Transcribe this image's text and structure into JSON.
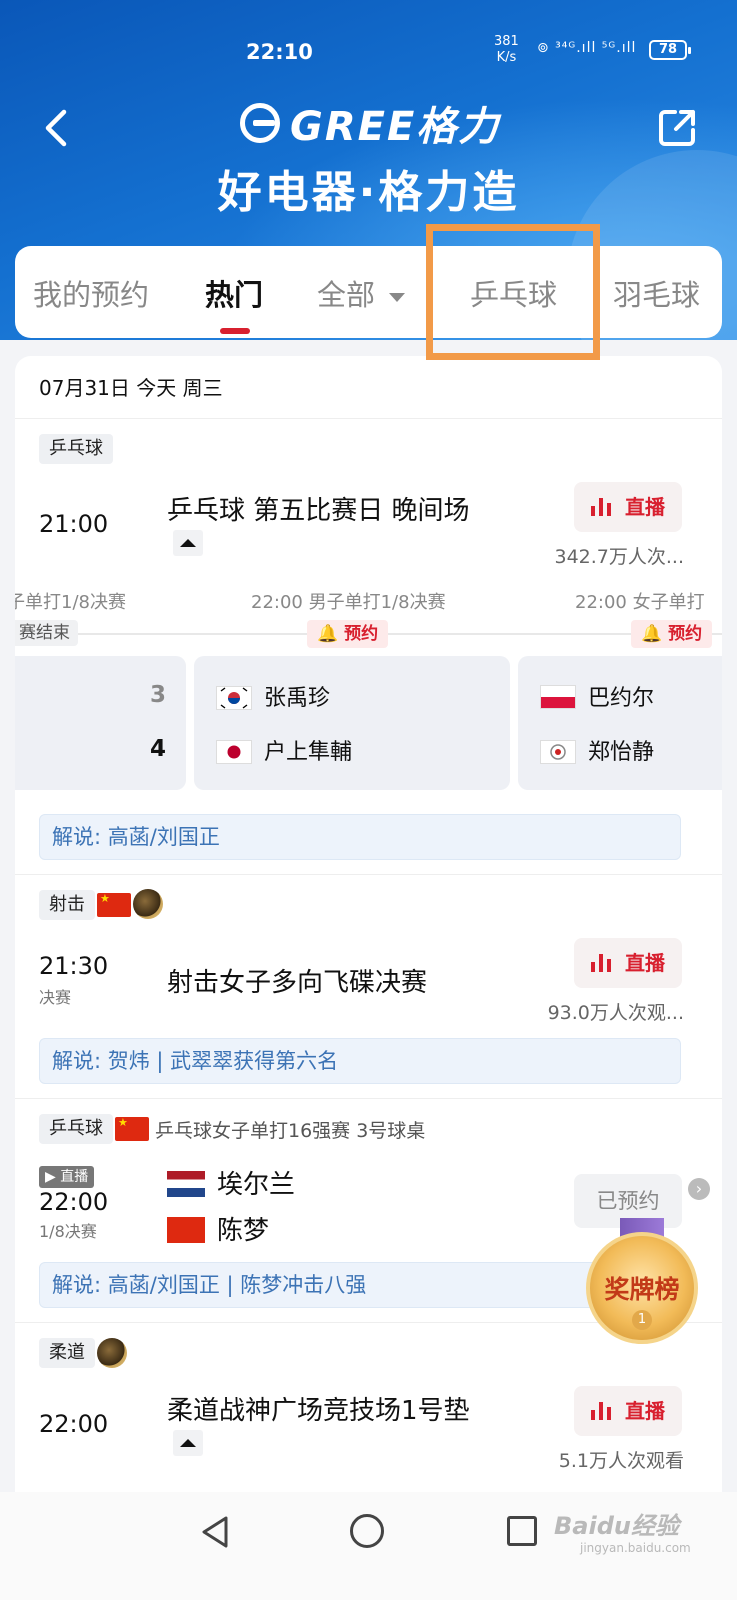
{
  "status_bar": {
    "time": "22:10",
    "speed_value": "381",
    "speed_unit": "K/s",
    "signal": "⊚ ³⁴ᴳ.ıll ⁵ᴳ.ıll",
    "battery": "78"
  },
  "header": {
    "brand": "GREE格力",
    "slogan": "好电器·格力造"
  },
  "tabs": [
    {
      "label": "我的预约"
    },
    {
      "label": "热门"
    },
    {
      "label": "全部"
    },
    {
      "label": "乒乓球"
    },
    {
      "label": "羽毛球"
    }
  ],
  "date_header": "07月31日 今天 周三",
  "events": [
    {
      "tag": "乒乓球",
      "time": "21:00",
      "title": "乒乓球 第五比赛日 晚间场",
      "button": "直播",
      "viewers": "342.7万人次..."
    },
    {
      "tag": "射击",
      "time": "21:30",
      "sub": "决赛",
      "title": "射击女子多向飞碟决赛",
      "button": "直播",
      "viewers": "93.0万人次观...",
      "commentary": "解说: 贺炜 | 武翠翠获得第六名"
    },
    {
      "tag": "乒乓球",
      "headline": "乒乓球女子单打16强赛 3号球桌",
      "live_badge": "▶ 直播",
      "time": "22:00",
      "sub": "1/8决赛",
      "team_a": "埃尔兰",
      "team_b": "陈梦",
      "button": "已预约",
      "commentary": "解说: 高菡/刘国正 | 陈梦冲击八强"
    },
    {
      "tag": "柔道",
      "time": "22:00",
      "title": "柔道战神广场竞技场1号垫",
      "button": "直播",
      "viewers": "5.1万人次观看"
    }
  ],
  "matches": {
    "times": [
      "子单打1/8决赛",
      "22:00 男子单打1/8决赛",
      "22:00 女子单打"
    ],
    "state": "赛结束",
    "remind_label": "预约",
    "remind_label_2": "预约",
    "left_scores": [
      "3",
      "4"
    ],
    "center_players": [
      "张禹珍",
      "户上隼輔"
    ],
    "right_players": [
      "巴约尔",
      "郑怡静"
    ],
    "commentary": "解说: 高菡/刘国正"
  },
  "medal_badge": {
    "label": "奖牌榜",
    "rank": "1"
  },
  "watermark": {
    "main": "Baidu经验",
    "sub": "jingyan.baidu.com"
  },
  "colors": {
    "accent": "#d8202f",
    "header_blue": "#1470d0",
    "highlight": "#f29a48"
  }
}
